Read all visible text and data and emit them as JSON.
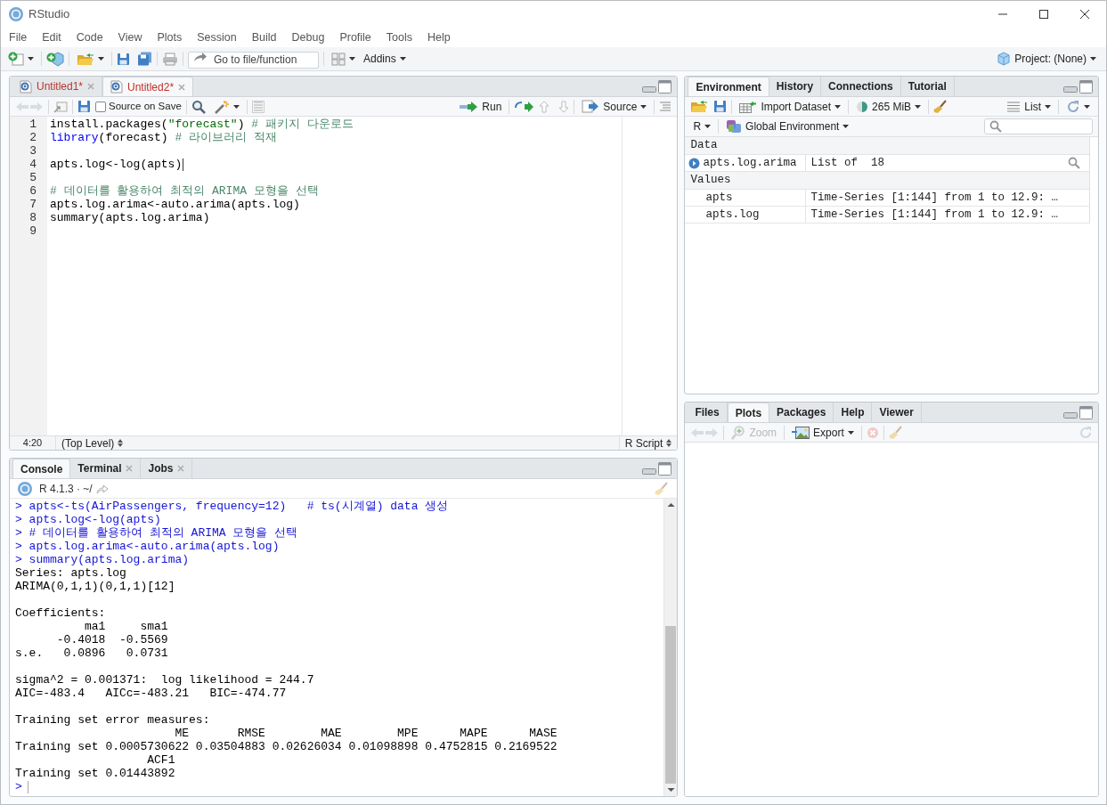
{
  "window": {
    "title": "RStudio"
  },
  "menu": [
    "File",
    "Edit",
    "Code",
    "View",
    "Plots",
    "Session",
    "Build",
    "Debug",
    "Profile",
    "Tools",
    "Help"
  ],
  "toolbar": {
    "goto_placeholder": "Go to file/function",
    "addins": "Addins",
    "project": "Project: (None)"
  },
  "editor": {
    "tabs": [
      {
        "label": "Untitled1*",
        "selected": false
      },
      {
        "label": "Untitled2*",
        "selected": true
      }
    ],
    "source_on_save": {
      "label": "Source on Save",
      "checked": false
    },
    "run": "Run",
    "source": "Source",
    "lines": [
      {
        "number": "1",
        "cursor": false,
        "tokens": [
          {
            "kind": "plain",
            "text": "install.packages("
          },
          {
            "kind": "string",
            "text": "\"forecast\""
          },
          {
            "kind": "plain",
            "text": ") "
          },
          {
            "kind": "comment",
            "text": "# 패키지 다운로드"
          }
        ]
      },
      {
        "number": "2",
        "cursor": false,
        "tokens": [
          {
            "kind": "keyword",
            "text": "library"
          },
          {
            "kind": "plain",
            "text": "(forecast) "
          },
          {
            "kind": "comment",
            "text": "# 라이브러리 적재"
          }
        ]
      },
      {
        "number": "3",
        "cursor": false
      },
      {
        "number": "4",
        "cursor": true,
        "tokens": [
          {
            "kind": "plain",
            "text": "apts.log<-log(apts)"
          }
        ]
      },
      {
        "number": "5",
        "cursor": false
      },
      {
        "number": "6",
        "cursor": false,
        "tokens": [
          {
            "kind": "comment",
            "text": "# 데이터를 활용하여 최적의 ARIMA 모형을 선택"
          }
        ]
      },
      {
        "number": "7",
        "cursor": false,
        "tokens": [
          {
            "kind": "plain",
            "text": "apts.log.arima<-auto.arima(apts.log)"
          }
        ]
      },
      {
        "number": "8",
        "cursor": false,
        "tokens": [
          {
            "kind": "plain",
            "text": "summary(apts.log.arima)"
          }
        ]
      },
      {
        "number": "9",
        "cursor": false
      }
    ],
    "status": {
      "position": "4:20",
      "scope": "(Top Level)",
      "filetype": "R Script"
    }
  },
  "console": {
    "tabs": [
      {
        "label": "Console",
        "selected": true,
        "closable": false
      },
      {
        "label": "Terminal",
        "selected": false,
        "closable": true
      },
      {
        "label": "Jobs",
        "selected": false,
        "closable": true
      }
    ],
    "header": "R 4.1.3 · ~/",
    "lines": [
      {
        "kind": "input",
        "text": "> apts<-ts(AirPassengers, frequency=12)   # ts(시계열) data 생성"
      },
      {
        "kind": "input",
        "text": "> apts.log<-log(apts)"
      },
      {
        "kind": "input",
        "text": "> # 데이터를 활용하여 최적의 ARIMA 모형을 선택"
      },
      {
        "kind": "input",
        "text": "> apts.log.arima<-auto.arima(apts.log)"
      },
      {
        "kind": "input",
        "text": "> summary(apts.log.arima)"
      },
      {
        "kind": "output",
        "text": "Series: apts.log"
      },
      {
        "kind": "output",
        "text": "ARIMA(0,1,1)(0,1,1)[12]"
      },
      {
        "kind": "blank"
      },
      {
        "kind": "output",
        "text": "Coefficients:"
      },
      {
        "kind": "output",
        "text": "          ma1     sma1"
      },
      {
        "kind": "output",
        "text": "      -0.4018  -0.5569"
      },
      {
        "kind": "output",
        "text": "s.e.   0.0896   0.0731"
      },
      {
        "kind": "blank"
      },
      {
        "kind": "output",
        "text": "sigma^2 = 0.001371:  log likelihood = 244.7"
      },
      {
        "kind": "output",
        "text": "AIC=-483.4   AICc=-483.21   BIC=-474.77"
      },
      {
        "kind": "blank"
      },
      {
        "kind": "output",
        "text": "Training set error measures:"
      },
      {
        "kind": "output",
        "text": "                       ME       RMSE        MAE        MPE      MAPE      MASE"
      },
      {
        "kind": "output",
        "text": "Training set 0.0005730622 0.03504883 0.02626034 0.01098898 0.4752815 0.2169522"
      },
      {
        "kind": "output",
        "text": "                   ACF1"
      },
      {
        "kind": "output",
        "text": "Training set 0.01443892"
      },
      {
        "kind": "prompt",
        "text": ">"
      }
    ]
  },
  "environment": {
    "tabs": [
      {
        "label": "Environment",
        "selected": true
      },
      {
        "label": "History",
        "selected": false
      },
      {
        "label": "Connections",
        "selected": false
      },
      {
        "label": "Tutorial",
        "selected": false
      }
    ],
    "import": "Import Dataset",
    "memory": "265 MiB",
    "view": "List",
    "language": "R",
    "scope": "Global Environment",
    "sections": [
      {
        "title": "Data",
        "rows": [
          {
            "kind": "data",
            "name": "apts.log.arima",
            "value": "List of  18"
          }
        ]
      },
      {
        "title": "Values",
        "rows": [
          {
            "kind": "value",
            "name": "apts",
            "value": "Time-Series [1:144] from 1 to 12.9: …"
          },
          {
            "kind": "value",
            "name": "apts.log",
            "value": "Time-Series [1:144] from 1 to 12.9: …"
          }
        ]
      }
    ]
  },
  "files": {
    "tabs": [
      {
        "label": "Files",
        "selected": false
      },
      {
        "label": "Plots",
        "selected": true
      },
      {
        "label": "Packages",
        "selected": false
      },
      {
        "label": "Help",
        "selected": false
      },
      {
        "label": "Viewer",
        "selected": false
      }
    ],
    "zoom": {
      "label": "Zoom",
      "disabled": true
    },
    "export": "Export"
  }
}
